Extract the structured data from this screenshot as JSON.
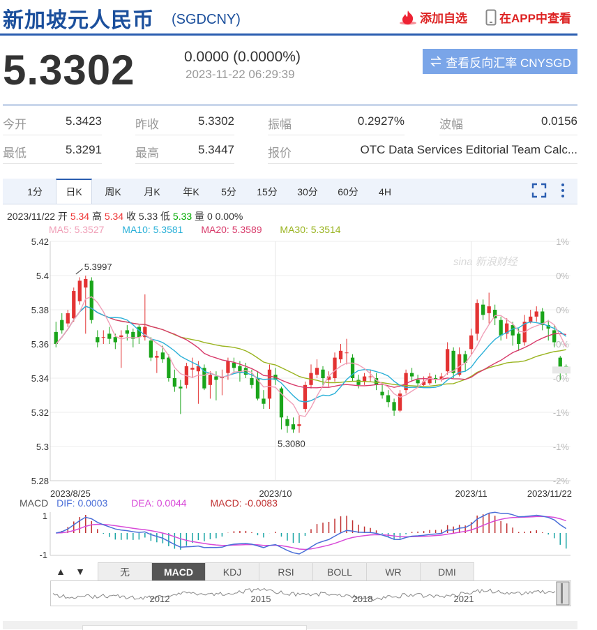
{
  "header": {
    "title": "新加坡元人民币",
    "code": "(SGDCNY)",
    "fav_label": "添加自选",
    "app_label": "在APP中查看",
    "price": "5.3302",
    "change": "0.0000 (0.0000%)",
    "time": "2023-11-22 06:29:39",
    "reverse_label": "查看反向汇率 CNYSGD"
  },
  "stats": {
    "open_label": "今开",
    "open": "5.3423",
    "prev_label": "昨收",
    "prev": "5.3302",
    "amp_label": "振幅",
    "amp": "0.2927%",
    "wave_label": "波幅",
    "wave": "0.0156",
    "low_label": "最低",
    "low": "5.3291",
    "high_label": "最高",
    "high": "5.3447",
    "quote_label": "报价",
    "quote": "OTC Data Services Editorial Team Calc..."
  },
  "tabs": [
    "1分",
    "日K",
    "周K",
    "月K",
    "年K",
    "5分",
    "15分",
    "30分",
    "60分",
    "4H"
  ],
  "active_tab": "日K",
  "kline_info": {
    "date": "2023/11/22",
    "open_label": "开",
    "open": "5.34",
    "high_label": "高",
    "high": "5.34",
    "close_label": "收",
    "close": "5.33",
    "low_label": "低",
    "low": "5.33",
    "vol_label": "量",
    "vol": "0",
    "pct": "0.00%"
  },
  "ma": {
    "ma5": "MA5: 5.3527",
    "ma10": "MA10: 5.3581",
    "ma20": "MA20: 5.3589",
    "ma30": "MA30: 5.3514",
    "ma5_color": "#f0a0b8",
    "ma10_color": "#2ab0d8",
    "ma20_color": "#d83a6a",
    "ma30_color": "#9ab420"
  },
  "macd": {
    "label": "MACD",
    "dif": "DIF: 0.0003",
    "dea": "DEA: 0.0044",
    "macd": "MACD: -0.0083",
    "y_top": "1",
    "y_bottom": "-1"
  },
  "indicator_tabs": [
    "无",
    "MACD",
    "KDJ",
    "RSI",
    "BOLL",
    "WR",
    "DMI"
  ],
  "active_indicator": "MACD",
  "range_years": [
    "2012",
    "2015",
    "2018",
    "2021"
  ],
  "colors": {
    "up": "#e33333",
    "down": "#1aa51a",
    "brand": "#1b4f9c",
    "accent": "#7aa5e8"
  },
  "chart_data": {
    "type": "candlestick",
    "y_ticks": [
      "5.42",
      "5.4",
      "5.38",
      "5.36",
      "5.34",
      "5.32",
      "5.3",
      "5.28"
    ],
    "pct_ticks": [
      "1%",
      "0%",
      "0%",
      "-0%",
      "-0%",
      "-1%",
      "-1%",
      "-2%"
    ],
    "ylim": [
      5.28,
      5.42
    ],
    "x_labels": [
      "2023/8/25",
      "2023/10",
      "2023/11",
      "2023/11/22"
    ],
    "annotations": [
      {
        "text": "5.3997"
      },
      {
        "text": "5.3080"
      }
    ],
    "candles": [
      [
        5.367,
        5.36,
        5.373,
        5.358
      ],
      [
        5.374,
        5.368,
        5.378,
        5.366
      ],
      [
        5.372,
        5.378,
        5.38,
        5.37
      ],
      [
        5.375,
        5.391,
        5.393,
        5.373
      ],
      [
        5.385,
        5.397,
        5.399,
        5.383
      ],
      [
        5.393,
        5.398,
        5.4,
        5.366
      ],
      [
        5.397,
        5.374,
        5.399,
        5.372
      ],
      [
        5.364,
        5.361,
        5.368,
        5.358
      ],
      [
        5.364,
        5.364,
        5.368,
        5.36
      ],
      [
        5.366,
        5.363,
        5.37,
        5.36
      ],
      [
        5.364,
        5.361,
        5.366,
        5.357
      ],
      [
        5.364,
        5.365,
        5.368,
        5.346
      ],
      [
        5.368,
        5.366,
        5.371,
        5.362
      ],
      [
        5.367,
        5.363,
        5.369,
        5.358
      ],
      [
        5.37,
        5.364,
        5.371,
        5.36
      ],
      [
        5.364,
        5.37,
        5.389,
        5.362
      ],
      [
        5.362,
        5.352,
        5.364,
        5.35
      ],
      [
        5.352,
        5.353,
        5.356,
        5.343
      ],
      [
        5.355,
        5.351,
        5.359,
        5.349
      ],
      [
        5.352,
        5.34,
        5.354,
        5.338
      ],
      [
        5.34,
        5.335,
        5.345,
        5.332
      ],
      [
        5.335,
        5.334,
        5.339,
        5.319
      ],
      [
        5.336,
        5.347,
        5.349,
        5.334
      ],
      [
        5.345,
        5.346,
        5.352,
        5.34
      ],
      [
        5.344,
        5.347,
        5.35,
        5.325
      ],
      [
        5.346,
        5.334,
        5.348,
        5.333
      ],
      [
        5.336,
        5.342,
        5.344,
        5.328
      ],
      [
        5.341,
        5.339,
        5.344,
        5.327
      ],
      [
        5.34,
        5.341,
        5.345,
        5.33
      ],
      [
        5.343,
        5.35,
        5.352,
        5.339
      ],
      [
        5.349,
        5.346,
        5.352,
        5.343
      ],
      [
        5.347,
        5.343,
        5.35,
        5.338
      ],
      [
        5.346,
        5.342,
        5.349,
        5.34
      ],
      [
        5.34,
        5.336,
        5.345,
        5.334
      ],
      [
        5.34,
        5.328,
        5.344,
        5.327
      ],
      [
        5.328,
        5.325,
        5.333,
        5.322
      ],
      [
        5.328,
        5.345,
        5.348,
        5.322
      ],
      [
        5.342,
        5.339,
        5.346,
        5.336
      ],
      [
        5.334,
        5.317,
        5.335,
        5.31
      ],
      [
        5.316,
        5.312,
        5.318,
        5.308
      ],
      [
        5.313,
        5.31,
        5.317,
        5.308
      ],
      [
        5.312,
        5.313,
        5.318,
        5.308
      ],
      [
        5.322,
        5.336,
        5.338,
        5.32
      ],
      [
        5.336,
        5.343,
        5.348,
        5.334
      ],
      [
        5.342,
        5.346,
        5.351,
        5.34
      ],
      [
        5.345,
        5.34,
        5.347,
        5.336
      ],
      [
        5.339,
        5.341,
        5.344,
        5.335
      ],
      [
        5.34,
        5.352,
        5.355,
        5.338
      ],
      [
        5.351,
        5.356,
        5.36,
        5.349
      ],
      [
        5.355,
        5.355,
        5.363,
        5.348
      ],
      [
        5.352,
        5.34,
        5.354,
        5.338
      ],
      [
        5.339,
        5.336,
        5.342,
        5.334
      ],
      [
        5.338,
        5.341,
        5.343,
        5.336
      ],
      [
        5.341,
        5.341,
        5.345,
        5.338
      ],
      [
        5.34,
        5.336,
        5.343,
        5.333
      ],
      [
        5.332,
        5.33,
        5.337,
        5.328
      ],
      [
        5.33,
        5.326,
        5.333,
        5.323
      ],
      [
        5.326,
        5.321,
        5.328,
        5.318
      ],
      [
        5.321,
        5.331,
        5.333,
        5.32
      ],
      [
        5.333,
        5.343,
        5.345,
        5.331
      ],
      [
        5.343,
        5.341,
        5.346,
        5.338
      ],
      [
        5.339,
        5.337,
        5.342,
        5.335
      ],
      [
        5.336,
        5.338,
        5.341,
        5.335
      ],
      [
        5.337,
        5.341,
        5.343,
        5.336
      ],
      [
        5.34,
        5.339,
        5.342,
        5.337
      ],
      [
        5.339,
        5.341,
        5.343,
        5.338
      ],
      [
        5.344,
        5.357,
        5.361,
        5.342
      ],
      [
        5.356,
        5.343,
        5.358,
        5.34
      ],
      [
        5.342,
        5.354,
        5.358,
        5.341
      ],
      [
        5.354,
        5.349,
        5.356,
        5.344
      ],
      [
        5.357,
        5.365,
        5.369,
        5.354
      ],
      [
        5.366,
        5.384,
        5.386,
        5.362
      ],
      [
        5.383,
        5.377,
        5.386,
        5.374
      ],
      [
        5.378,
        5.382,
        5.39,
        5.372
      ],
      [
        5.38,
        5.375,
        5.383,
        5.371
      ],
      [
        5.374,
        5.365,
        5.376,
        5.362
      ],
      [
        5.366,
        5.372,
        5.375,
        5.363
      ],
      [
        5.371,
        5.365,
        5.373,
        5.359
      ],
      [
        5.366,
        5.36,
        5.369,
        5.356
      ],
      [
        5.361,
        5.373,
        5.377,
        5.359
      ],
      [
        5.373,
        5.376,
        5.38,
        5.372
      ],
      [
        5.376,
        5.379,
        5.382,
        5.373
      ],
      [
        5.379,
        5.371,
        5.381,
        5.368
      ],
      [
        5.371,
        5.369,
        5.374,
        5.362
      ],
      [
        5.368,
        5.361,
        5.371,
        5.358
      ],
      [
        5.352,
        5.345,
        5.353,
        5.339
      ],
      [
        5.347,
        5.345,
        5.348,
        5.342
      ]
    ],
    "macd_hist": []
  }
}
